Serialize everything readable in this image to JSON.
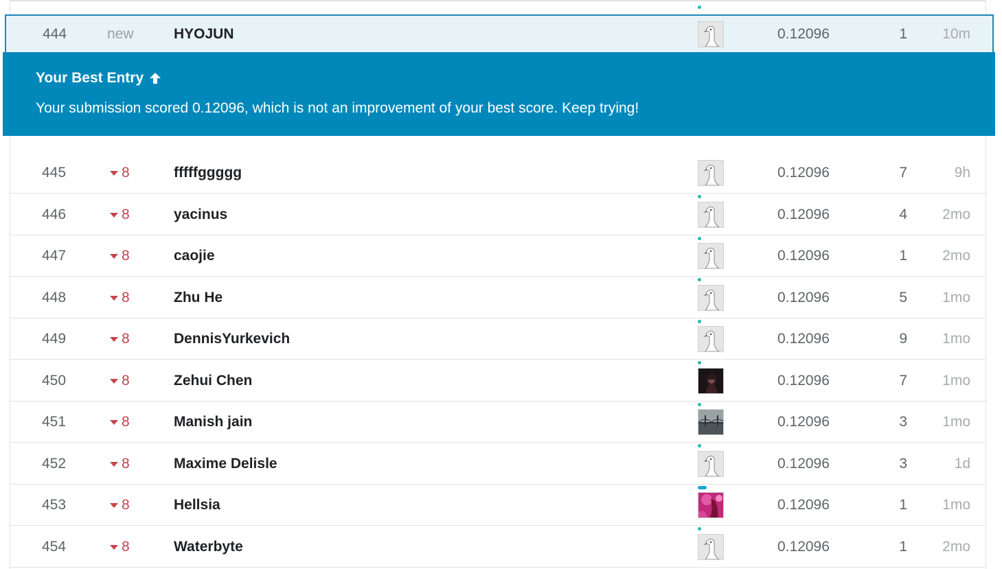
{
  "own_row": {
    "rank": "444",
    "change": "new",
    "name": "HYOJUN",
    "score": "0.12096",
    "entries": "1",
    "last": "10m"
  },
  "banner": {
    "title": "Your Best Entry",
    "title_icon": "arrow-up-icon",
    "message": "Your submission scored 0.12096, which is not an improvement of your best score. Keep trying!"
  },
  "rows": [
    {
      "rank": "445",
      "change": "8",
      "name": "fffffggggg",
      "score": "0.12096",
      "entries": "7",
      "last": "9h",
      "avatar": "goose"
    },
    {
      "rank": "446",
      "change": "8",
      "name": "yacinus",
      "score": "0.12096",
      "entries": "4",
      "last": "2mo",
      "avatar": "goose"
    },
    {
      "rank": "447",
      "change": "8",
      "name": "caojie",
      "score": "0.12096",
      "entries": "1",
      "last": "2mo",
      "avatar": "goose"
    },
    {
      "rank": "448",
      "change": "8",
      "name": "Zhu He",
      "score": "0.12096",
      "entries": "5",
      "last": "1mo",
      "avatar": "goose"
    },
    {
      "rank": "449",
      "change": "8",
      "name": "DennisYurkevich",
      "score": "0.12096",
      "entries": "9",
      "last": "1mo",
      "avatar": "goose"
    },
    {
      "rank": "450",
      "change": "8",
      "name": "Zehui Chen",
      "score": "0.12096",
      "entries": "7",
      "last": "1mo",
      "avatar": "dark-portrait"
    },
    {
      "rank": "451",
      "change": "8",
      "name": "Manish jain",
      "score": "0.12096",
      "entries": "3",
      "last": "1mo",
      "avatar": "bridge-photo"
    },
    {
      "rank": "452",
      "change": "8",
      "name": "Maxime Delisle",
      "score": "0.12096",
      "entries": "3",
      "last": "1d",
      "avatar": "goose"
    },
    {
      "rank": "453",
      "change": "8",
      "name": "Hellsia",
      "score": "0.12096",
      "entries": "1",
      "last": "1mo",
      "avatar": "pink-photo"
    },
    {
      "rank": "454",
      "change": "8",
      "name": "Waterbyte",
      "score": "0.12096",
      "entries": "1",
      "last": "2mo",
      "avatar": "goose"
    }
  ],
  "colors": {
    "banner_bg": "#0088bb",
    "own_row_bg": "#e8f3f8",
    "own_row_border": "#1a87b8",
    "down_change": "#c5454d",
    "tier_dot": "#20beac"
  }
}
